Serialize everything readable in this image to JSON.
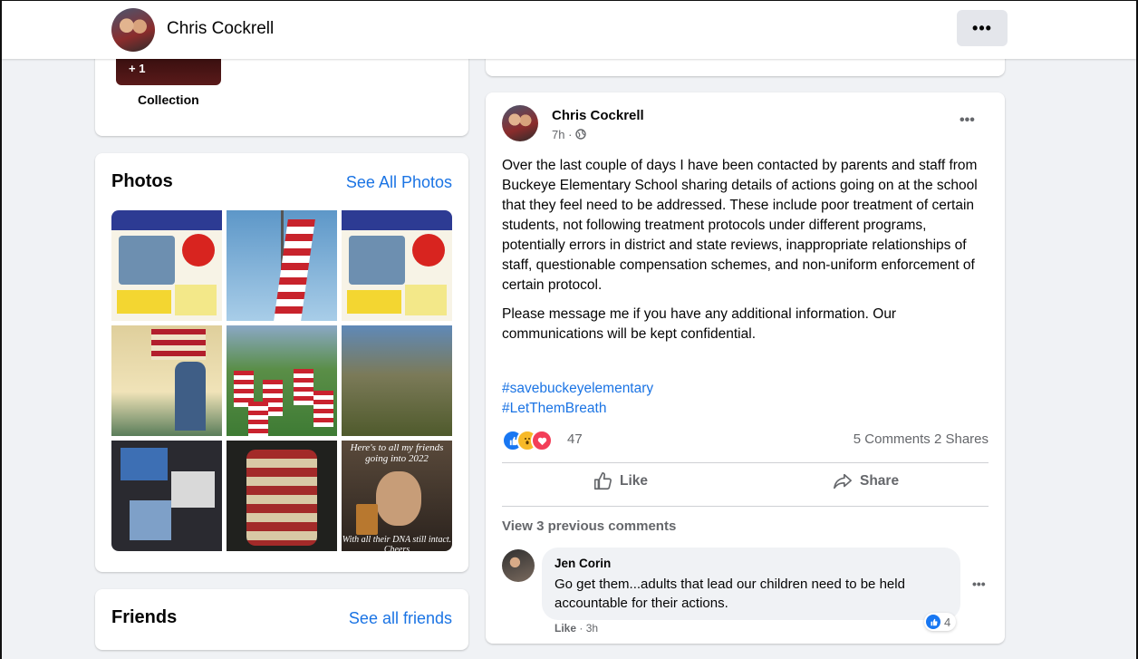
{
  "profile": {
    "name": "Chris Cockrell",
    "more_label": "•••"
  },
  "collection": {
    "badge": "+ 1",
    "label": "Collection"
  },
  "photos": {
    "title": "Photos",
    "see_all": "See All Photos",
    "meme_top": "Here's to all my friends going into 2022",
    "meme_bottom": "With all their DNA still intact. Cheers"
  },
  "friends": {
    "title": "Friends",
    "see_all": "See all friends"
  },
  "post": {
    "author": "Chris Cockrell",
    "time": "7h ·",
    "more": "•••",
    "paragraph1": "Over the last couple of days I have been contacted by parents and staff from Buckeye Elementary School sharing details of actions going on at the school that they feel need to be addressed. These include poor treatment of certain students, not following treatment protocols under different programs, potentially errors in district and state reviews,  inappropriate relationships of staff, questionable compensation schemes, and non-uniform enforcement of certain protocol.",
    "paragraph2": "Please message me if you have any additional information. Our communications will be kept confidential.",
    "hashtag1": "#savebuckeyelementary",
    "hashtag2": "#LetThemBreath",
    "reaction_count": "47",
    "counts": "5 Comments  2 Shares",
    "like_label": "Like",
    "share_label": "Share",
    "view_previous": "View 3 previous comments"
  },
  "comment": {
    "author": "Jen Corin",
    "text": "Go get them...adults that lead our children need to be held accountable for their actions.",
    "like_label": "Like",
    "time": "· 3h",
    "reaction_count": "4",
    "more": "•••"
  },
  "colors": {
    "link": "#1b74e4",
    "like": "#1877f2",
    "love": "#f33e58",
    "wow": "#f7b928"
  }
}
